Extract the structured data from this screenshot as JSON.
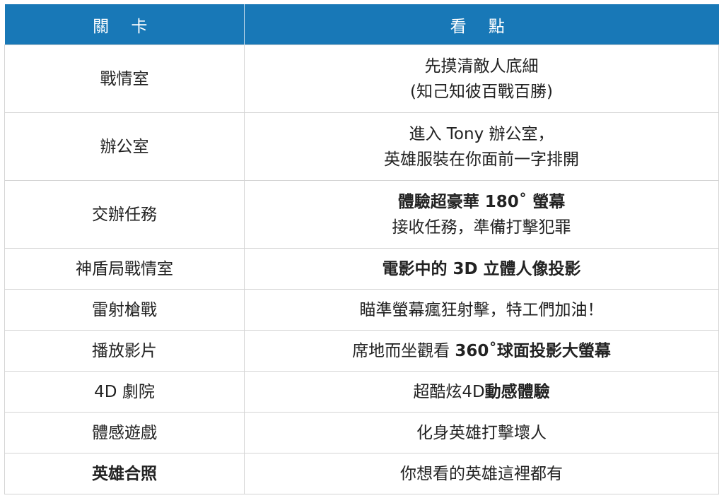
{
  "header": {
    "col1": "關 卡",
    "col2": "看 點"
  },
  "rows": [
    {
      "stage": "戰情室",
      "stage_bold": false,
      "line1": [
        {
          "text": "先摸清敵人底細",
          "bold": false
        }
      ],
      "line2": [
        {
          "text": "(知己知彼百戰百勝)",
          "bold": false
        }
      ]
    },
    {
      "stage": "辦公室",
      "stage_bold": false,
      "line1": [
        {
          "text": "進入 Tony 辦公室，",
          "bold": false
        }
      ],
      "line2": [
        {
          "text": "英雄服裝在你面前一字排開",
          "bold": false
        }
      ]
    },
    {
      "stage": "交辦任務",
      "stage_bold": false,
      "line1": [
        {
          "text": "體驗超豪華 180˚ 螢幕",
          "bold": true
        }
      ],
      "line2": [
        {
          "text": "接收任務，準備打擊犯罪",
          "bold": false
        }
      ]
    },
    {
      "stage": "神盾局戰情室",
      "stage_bold": false,
      "line1": [
        {
          "text": "電影中的 3D 立體人像投影",
          "bold": true
        }
      ]
    },
    {
      "stage": "雷射槍戰",
      "stage_bold": false,
      "line1": [
        {
          "text": "瞄準螢幕瘋狂射擊，特工們加油！",
          "bold": false
        }
      ]
    },
    {
      "stage": "播放影片",
      "stage_bold": false,
      "line1": [
        {
          "text": "席地而坐觀看 ",
          "bold": false
        },
        {
          "text": "360˚球面投影大螢幕",
          "bold": true
        }
      ]
    },
    {
      "stage": "4D 劇院",
      "stage_bold": false,
      "line1": [
        {
          "text": "超酷炫4D",
          "bold": false
        },
        {
          "text": "動感體驗",
          "bold": true
        }
      ]
    },
    {
      "stage": "體感遊戲",
      "stage_bold": false,
      "line1": [
        {
          "text": "化身英雄打擊壞人",
          "bold": false
        }
      ]
    },
    {
      "stage": "英雄合照",
      "stage_bold": true,
      "line1": [
        {
          "text": "你想看的英雄這裡都有",
          "bold": false
        }
      ]
    }
  ],
  "colors": {
    "header_bg": "#1878b7",
    "header_text": "#ffffff",
    "border": "#d4d4d4",
    "text": "#222222"
  }
}
